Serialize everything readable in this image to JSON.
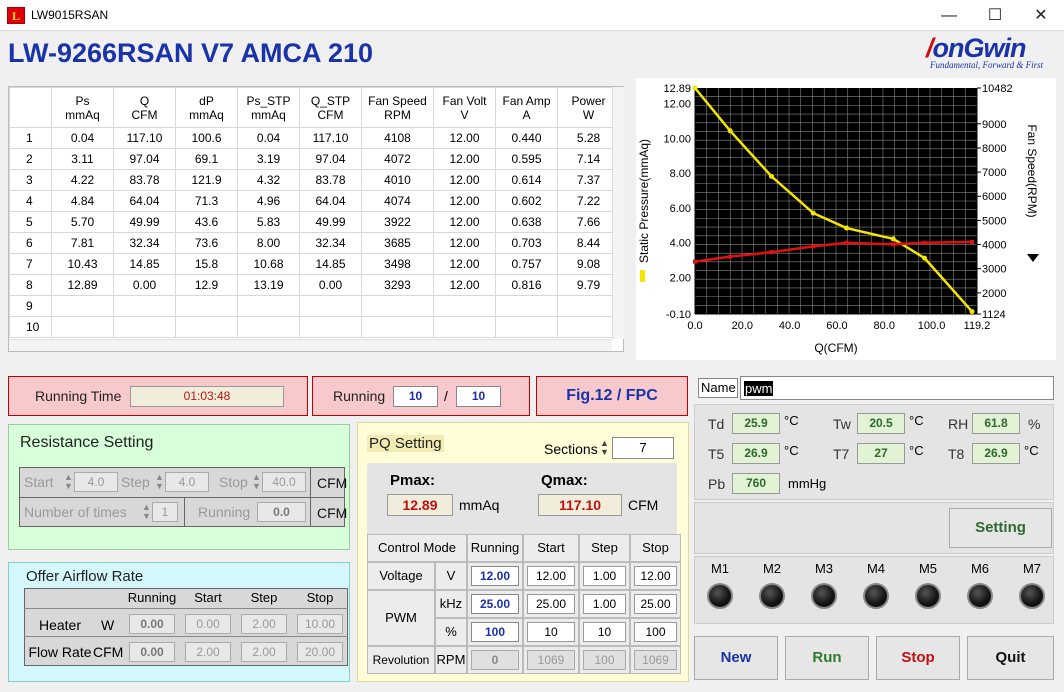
{
  "window": {
    "title": "LW9015RSAN",
    "app_icon": "L"
  },
  "app": {
    "title": "LW-9266RSAN V7 AMCA 210",
    "logo_main": "longWin",
    "logo_first": "/",
    "logo_rest": "onGwin",
    "logo_tag": "Fundamental, Forward & First"
  },
  "table": {
    "headers": [
      [
        "Ps",
        "mmAq"
      ],
      [
        "Q",
        "CFM"
      ],
      [
        "dP",
        "mmAq"
      ],
      [
        "Ps_STP",
        "mmAq"
      ],
      [
        "Q_STP",
        "CFM"
      ],
      [
        "Fan Speed",
        "RPM"
      ],
      [
        "Fan Volt",
        "V"
      ],
      [
        "Fan Amp",
        "A"
      ],
      [
        "Power",
        "W"
      ]
    ],
    "rows": [
      [
        "1",
        "0.04",
        "117.10",
        "100.6",
        "0.04",
        "117.10",
        "4108",
        "12.00",
        "0.440",
        "5.28"
      ],
      [
        "2",
        "3.11",
        "97.04",
        "69.1",
        "3.19",
        "97.04",
        "4072",
        "12.00",
        "0.595",
        "7.14"
      ],
      [
        "3",
        "4.22",
        "83.78",
        "121.9",
        "4.32",
        "83.78",
        "4010",
        "12.00",
        "0.614",
        "7.37"
      ],
      [
        "4",
        "4.84",
        "64.04",
        "71.3",
        "4.96",
        "64.04",
        "4074",
        "12.00",
        "0.602",
        "7.22"
      ],
      [
        "5",
        "5.70",
        "49.99",
        "43.6",
        "5.83",
        "49.99",
        "3922",
        "12.00",
        "0.638",
        "7.66"
      ],
      [
        "6",
        "7.81",
        "32.34",
        "73.6",
        "8.00",
        "32.34",
        "3685",
        "12.00",
        "0.703",
        "8.44"
      ],
      [
        "7",
        "10.43",
        "14.85",
        "15.8",
        "10.68",
        "14.85",
        "3498",
        "12.00",
        "0.757",
        "9.08"
      ],
      [
        "8",
        "12.89",
        "0.00",
        "12.9",
        "13.19",
        "0.00",
        "3293",
        "12.00",
        "0.816",
        "9.79"
      ],
      [
        "9",
        "",
        "",
        "",
        "",
        "",
        "",
        "",
        "",
        ""
      ],
      [
        "10",
        "",
        "",
        "",
        "",
        "",
        "",
        "",
        "",
        ""
      ]
    ]
  },
  "chart_data": {
    "type": "line",
    "xlabel": "Q(CFM)",
    "ylabel": "Static Pressure(mmAq)",
    "y2label": "Fan Speed(RPM)",
    "xlim": [
      0,
      119.2
    ],
    "ylim": [
      -0.1,
      12.89
    ],
    "y2lim": [
      1124,
      10482
    ],
    "x_ticks": [
      "0.0",
      "20.0",
      "40.0",
      "60.0",
      "80.0",
      "100.0",
      "119.2"
    ],
    "y_ticks": [
      "-0.10",
      "2.00",
      "4.00",
      "6.00",
      "8.00",
      "10.00",
      "12.00",
      "12.89"
    ],
    "y2_ticks": [
      "1124",
      "2000",
      "3000",
      "4000",
      "5000",
      "6000",
      "7000",
      "8000",
      "9000",
      "10482"
    ],
    "grid": true,
    "background": "#000000",
    "series": [
      {
        "color": "#f5e600",
        "x": [
          0,
          14.85,
          32.34,
          49.99,
          64.04,
          83.78,
          97.04,
          117.1
        ],
        "y": [
          12.89,
          10.43,
          7.81,
          5.7,
          4.84,
          4.22,
          3.11,
          0.04
        ]
      },
      {
        "color": "#e01010",
        "x": [
          0,
          14.85,
          32.34,
          49.99,
          64.04,
          83.78,
          97.04,
          117.1
        ],
        "y": [
          3293,
          3498,
          3685,
          3922,
          4074,
          4010,
          4072,
          4108
        ]
      }
    ]
  },
  "running_time": {
    "label": "Running Time",
    "value": "01:03:48"
  },
  "running": {
    "label": "Running",
    "current": "10",
    "sep": "/",
    "total": "10"
  },
  "fig": {
    "label": "Fig.12 / FPC"
  },
  "name": {
    "label": "Name",
    "value": "pwm"
  },
  "env": {
    "td_label": "Td",
    "td": "25.9",
    "tw_label": "Tw",
    "tw": "20.5",
    "rh_label": "RH",
    "rh": "61.8",
    "rh_unit": "%",
    "t5_label": "T5",
    "t5": "26.9",
    "t7_label": "T7",
    "t7": "27",
    "t8_label": "T8",
    "t8": "26.9",
    "deg_c": "°C",
    "pb_label": "Pb",
    "pb": "760",
    "pb_unit": "mmHg"
  },
  "resistance": {
    "title": "Resistance Setting",
    "start_label": "Start",
    "start": "4.0",
    "step_label": "Step",
    "step": "4.0",
    "stop_label": "Stop",
    "stop": "40.0",
    "unit": "CFM",
    "times_label": "Number of times",
    "times": "1",
    "running_label": "Running",
    "running": "0.0",
    "unit2": "CFM"
  },
  "airflow": {
    "title": "Offer Airflow Rate",
    "cols": [
      "Running",
      "Start",
      "Step",
      "Stop"
    ],
    "heater_label": "Heater",
    "heater_unit": "W",
    "heater": [
      "0.00",
      "0.00",
      "2.00",
      "10.00"
    ],
    "flow_label": "Flow Rate",
    "flow_unit": "CFM",
    "flow": [
      "0.00",
      "2.00",
      "2.00",
      "20.00"
    ]
  },
  "pq": {
    "title": "PQ Setting",
    "sections_label": "Sections",
    "sections": "7",
    "pmax_label": "Pmax:",
    "pmax": "12.89",
    "pmax_unit": "mmAq",
    "qmax_label": "Qmax:",
    "qmax": "117.10",
    "qmax_unit": "CFM",
    "cols": [
      "Control Mode",
      "Running",
      "Start",
      "Step",
      "Stop"
    ],
    "voltage_label": "Voltage",
    "voltage_unit": "V",
    "voltage": [
      "12.00",
      "12.00",
      "1.00",
      "12.00"
    ],
    "pwm_label": "PWM",
    "pwm_khz_unit": "kHz",
    "pwm_khz": [
      "25.00",
      "25.00",
      "1.00",
      "25.00"
    ],
    "pwm_pct_unit": "%",
    "pwm_pct": [
      "100",
      "10",
      "10",
      "100"
    ],
    "rev_label": "Revolution",
    "rev_unit": "RPM",
    "rev": [
      "0",
      "1069",
      "100",
      "1069"
    ]
  },
  "setting_button": "Setting",
  "motors": [
    "M1",
    "M2",
    "M3",
    "M4",
    "M5",
    "M6",
    "M7"
  ],
  "buttons": {
    "new": "New",
    "run": "Run",
    "stop": "Stop",
    "quit": "Quit"
  }
}
